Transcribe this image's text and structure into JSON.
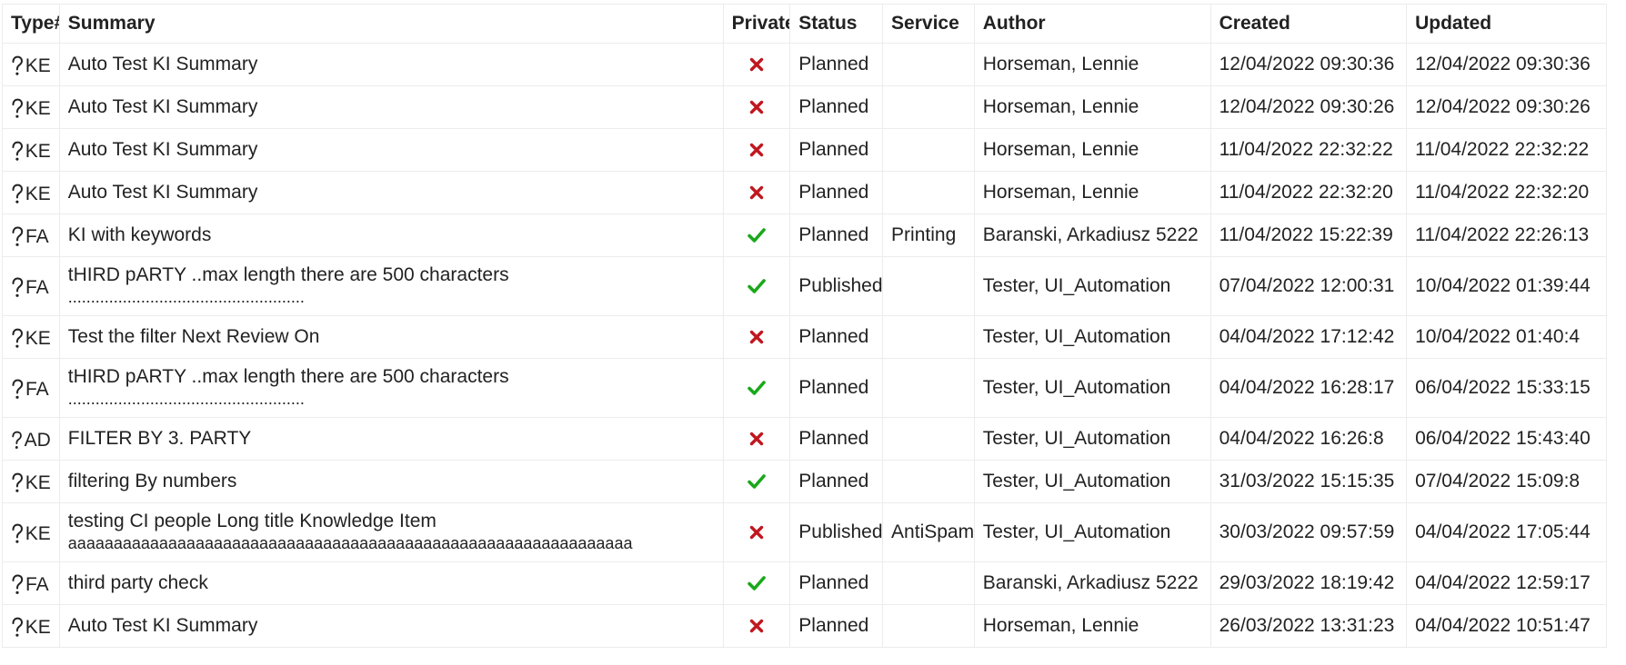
{
  "columns": {
    "type": "Type#",
    "summary": "Summary",
    "private": "Private",
    "status": "Status",
    "service": "Service",
    "author": "Author",
    "created": "Created",
    "updated": "Updated"
  },
  "colors": {
    "cross": "#c0171f",
    "check": "#1aa81a",
    "grid": "#ececec"
  },
  "icons": {
    "unknown_type": "question-mark-icon",
    "private_yes": "check-icon",
    "private_no": "cross-icon"
  },
  "rows": [
    {
      "type": "KE",
      "summary": "Auto Test KI Summary",
      "summary2": "",
      "private": false,
      "status": "Planned",
      "service": "",
      "author": "Horseman, Lennie",
      "created": "12/04/2022 09:30:36",
      "updated": "12/04/2022 09:30:36"
    },
    {
      "type": "KE",
      "summary": "Auto Test KI Summary",
      "summary2": "",
      "private": false,
      "status": "Planned",
      "service": "",
      "author": "Horseman, Lennie",
      "created": "12/04/2022 09:30:26",
      "updated": "12/04/2022 09:30:26"
    },
    {
      "type": "KE",
      "summary": "Auto Test KI Summary",
      "summary2": "",
      "private": false,
      "status": "Planned",
      "service": "",
      "author": "Horseman, Lennie",
      "created": "11/04/2022 22:32:22",
      "updated": "11/04/2022 22:32:22"
    },
    {
      "type": "KE",
      "summary": "Auto Test KI Summary",
      "summary2": "",
      "private": false,
      "status": "Planned",
      "service": "",
      "author": "Horseman, Lennie",
      "created": "11/04/2022 22:32:20",
      "updated": "11/04/2022 22:32:20"
    },
    {
      "type": "FA",
      "summary": "KI with keywords",
      "summary2": "",
      "private": true,
      "status": "Planned",
      "service": "Printing",
      "author": "Baranski, Arkadiusz 5222",
      "created": "11/04/2022 15:22:39",
      "updated": "11/04/2022 22:26:13"
    },
    {
      "type": "FA",
      "summary": "tHIRD pARTY ..max length there are 500 characters",
      "summary2": "....................................................",
      "private": true,
      "status": "Published",
      "service": "",
      "author": "Tester, UI_Automation",
      "created": "07/04/2022 12:00:31",
      "updated": "10/04/2022 01:39:44"
    },
    {
      "type": "KE",
      "summary": "Test the filter Next Review On",
      "summary2": "",
      "private": false,
      "status": "Planned",
      "service": "",
      "author": "Tester, UI_Automation",
      "created": "04/04/2022 17:12:42",
      "updated": "10/04/2022 01:40:4"
    },
    {
      "type": "FA",
      "summary": "tHIRD pARTY ..max length there are 500 characters",
      "summary2": "....................................................",
      "private": true,
      "status": "Planned",
      "service": "",
      "author": "Tester, UI_Automation",
      "created": "04/04/2022 16:28:17",
      "updated": "06/04/2022 15:33:15"
    },
    {
      "type": "AD",
      "summary": "FILTER BY 3. PARTY",
      "summary2": "",
      "private": false,
      "status": "Planned",
      "service": "",
      "author": "Tester, UI_Automation",
      "created": "04/04/2022 16:26:8",
      "updated": "06/04/2022 15:43:40"
    },
    {
      "type": "KE",
      "summary": "filtering By numbers",
      "summary2": "",
      "private": true,
      "status": "Planned",
      "service": "",
      "author": "Tester, UI_Automation",
      "created": "31/03/2022 15:15:35",
      "updated": "07/04/2022 15:09:8"
    },
    {
      "type": "KE",
      "summary": "testing CI people Long title Knowledge Item",
      "summary2": "aaaaaaaaaaaaaaaaaaaaaaaaaaaaaaaaaaaaaaaaaaaaaaaaaaaaaaaaaaaaaa",
      "private": false,
      "status": "Published",
      "service": "AntiSpam",
      "author": "Tester, UI_Automation",
      "created": "30/03/2022 09:57:59",
      "updated": "04/04/2022 17:05:44"
    },
    {
      "type": "FA",
      "summary": "third party check",
      "summary2": "",
      "private": true,
      "status": "Planned",
      "service": "",
      "author": "Baranski, Arkadiusz 5222",
      "created": "29/03/2022 18:19:42",
      "updated": "04/04/2022 12:59:17"
    },
    {
      "type": "KE",
      "summary": "Auto Test KI Summary",
      "summary2": "",
      "private": false,
      "status": "Planned",
      "service": "",
      "author": "Horseman, Lennie",
      "created": "26/03/2022 13:31:23",
      "updated": "04/04/2022 10:51:47"
    }
  ]
}
